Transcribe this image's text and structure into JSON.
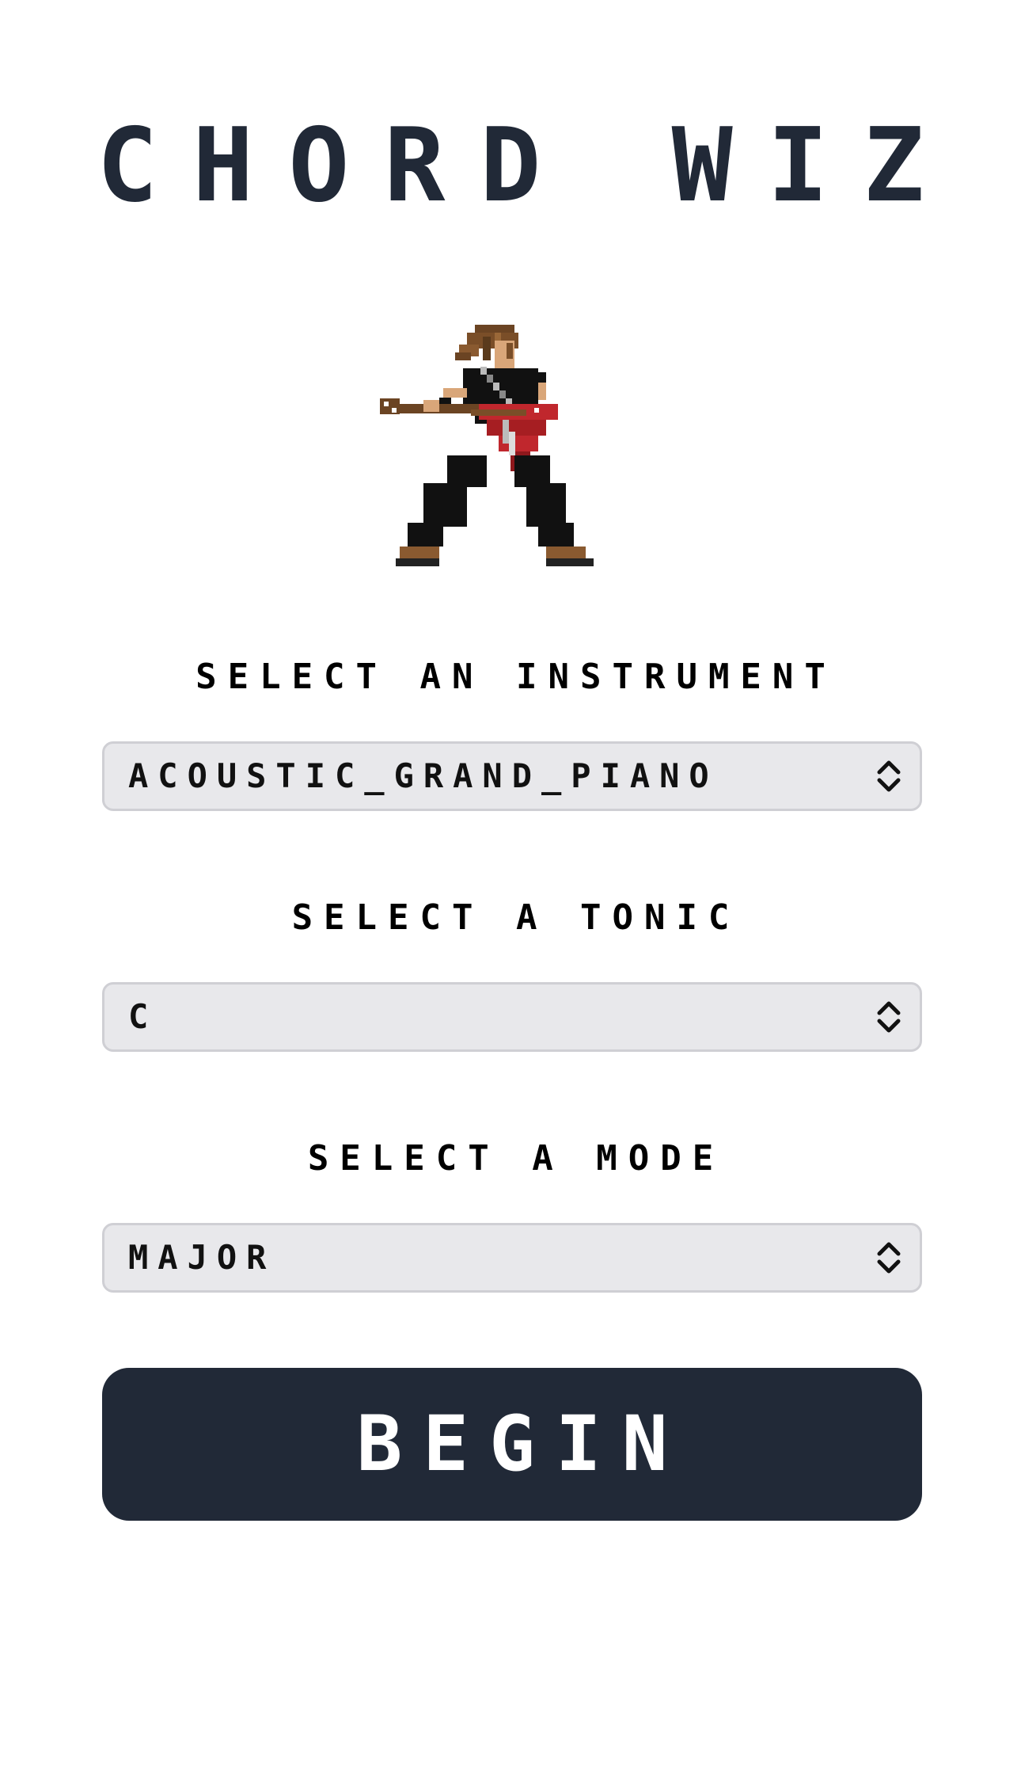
{
  "app": {
    "title": "CHORD WIZ"
  },
  "instrument": {
    "label": "SELECT AN INSTRUMENT",
    "value": "ACOUSTIC_GRAND_PIANO"
  },
  "tonic": {
    "label": "SELECT A TONIC",
    "value": "C"
  },
  "mode": {
    "label": "SELECT A MODE",
    "value": "MAJOR"
  },
  "actions": {
    "begin_label": "BEGIN"
  },
  "colors": {
    "primary": "#212937",
    "select_bg": "#e8e8eb",
    "select_border": "#cfcfd4",
    "button_text": "#ffffff"
  },
  "icons": {
    "sprite": "guitarist-sprite",
    "select_chevron": "chevron-up-down-icon"
  }
}
